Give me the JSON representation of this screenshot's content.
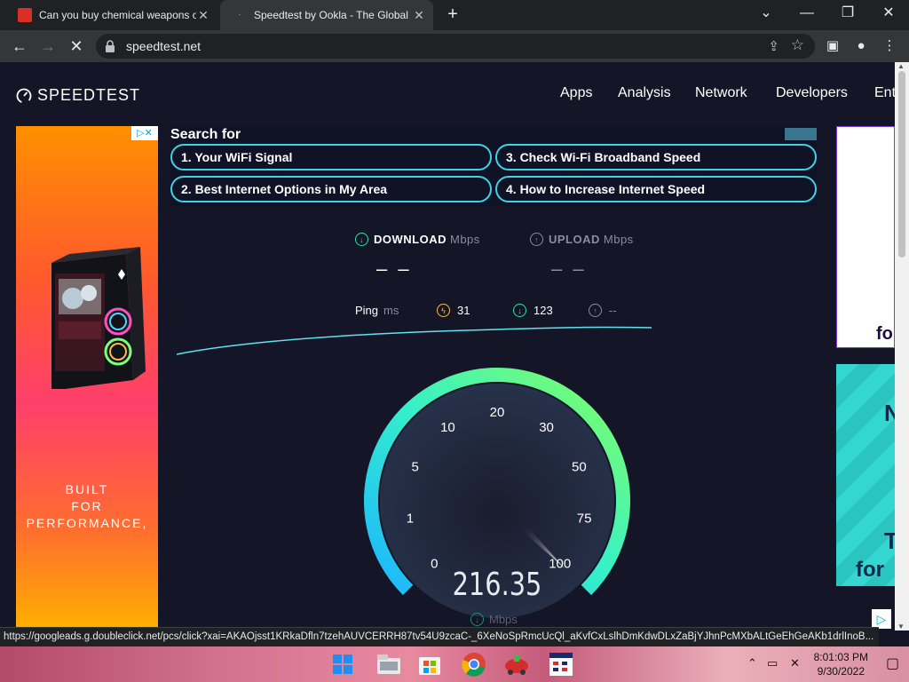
{
  "browser": {
    "tabs": [
      {
        "title": "Can you buy chemical weapons on",
        "close": "✕"
      },
      {
        "title": "Speedtest by Ookla - The Global",
        "close": "✕"
      }
    ],
    "new_tab": "+",
    "url": "speedtest.net",
    "window_controls": {
      "minimize": "—",
      "maximize": "❐",
      "close": "✕",
      "tab_search": "⌄"
    }
  },
  "site": {
    "logo_text": "SPEEDTEST",
    "nav": [
      "Apps",
      "Analysis",
      "Network",
      "Developers",
      "Ent"
    ]
  },
  "ad_left": {
    "choice": "▷✕",
    "slogan": [
      "BUILT",
      "FOR",
      "PERFORMANCE,"
    ]
  },
  "search_ad": {
    "label": "Search for",
    "items": [
      "1.  Your WiFi Signal",
      "3.  Check Wi-Fi Broadband Speed",
      "2.  Best Internet Options in My Area",
      "4.  How to Increase Internet Speed"
    ]
  },
  "speedtest": {
    "download": {
      "label": "DOWNLOAD",
      "unit": "Mbps",
      "value": "– –"
    },
    "upload": {
      "label": "UPLOAD",
      "unit": "Mbps",
      "value": "– –"
    },
    "ping": {
      "label": "Ping",
      "unit": "ms",
      "idle": "31",
      "download": "123",
      "upload": "--"
    },
    "gauge_value": 216.35,
    "gauge_value_text": "216.35",
    "gauge_unit": "Mbps",
    "gauge_ticks": [
      "0",
      "1",
      "5",
      "10",
      "20",
      "30",
      "50",
      "75",
      "100"
    ]
  },
  "ads_right": {
    "ad1_text": "fo",
    "ad2_texts": [
      "N",
      "T",
      "for"
    ],
    "choice": "▷"
  },
  "status_url": "https://googleads.g.doubleclick.net/pcs/click?xai=AKAOjsst1KRkaDfln7tzehAUVCERRH87tv54U9zcaC-_6XeNoSpRmcUcQl_aKvfCxLslhDmKdwDLxZaBjYJhnPcMXbALtGeEhGeAKb1drlInoB...",
  "taskbar": {
    "time": "8:01:03 PM",
    "date": "9/30/2022"
  },
  "colors": {
    "page_bg": "#141526",
    "accent_cyan": "#3fd3e6",
    "download_green": "#2fe0a8",
    "upload_purple": "#8a8ca3",
    "gauge_start": "#21c3ff",
    "gauge_end": "#7ffc6e"
  }
}
